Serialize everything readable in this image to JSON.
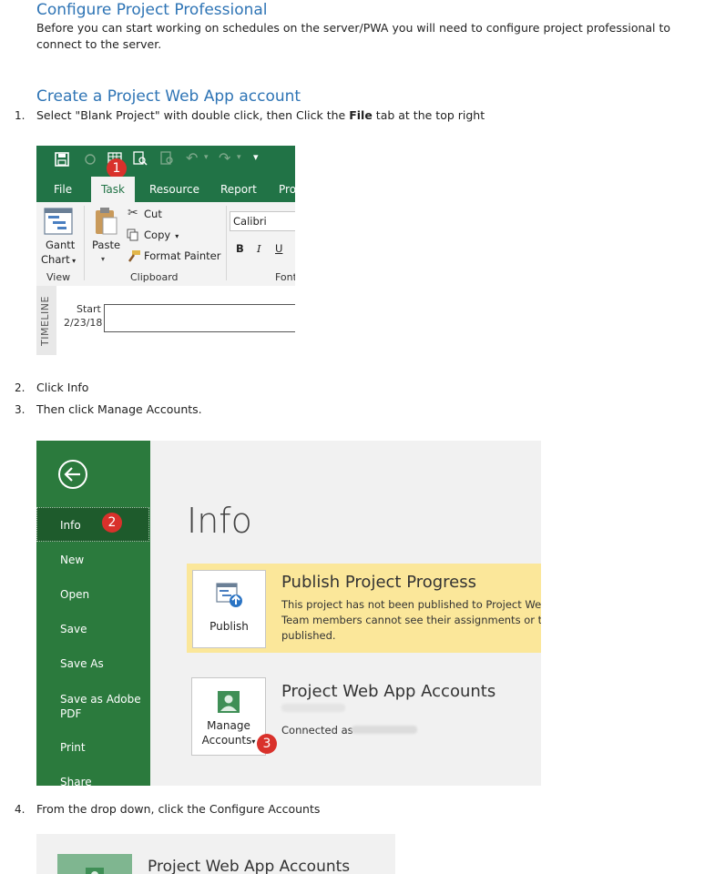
{
  "heading1": "Configure Project Professional",
  "intro": "Before you can start working on schedules on the server/PWA you will need to configure project professional to connect to the server.",
  "heading2": "Create a Project Web App account",
  "steps": [
    {
      "num": "1.",
      "text_a": "Select \"Blank Project\" with double click, then Click the ",
      "bold": "File",
      "text_b": " tab at the top right"
    },
    {
      "num": "2.",
      "text": "Click Info"
    },
    {
      "num": "3.",
      "text": "Then click Manage Accounts."
    },
    {
      "num": "4.",
      "text": "From the drop down, click the Configure Accounts"
    }
  ],
  "ribbon": {
    "badge": "1",
    "tabs": [
      "File",
      "Task",
      "Resource",
      "Report",
      "Pro"
    ],
    "gantt_label_1": "Gantt",
    "gantt_label_2": "Chart",
    "paste_label": "Paste",
    "cut_label": "Cut",
    "copy_label": "Copy",
    "format_painter_label": "Format Painter",
    "font_name": "Calibri",
    "bold_btn": "B",
    "italic_btn": "I",
    "underline_btn": "U",
    "group_view": "View",
    "group_clipboard": "Clipboard",
    "group_font": "Font",
    "timeline_label": "TIMELINE",
    "start_label": "Start",
    "start_date": "2/23/18"
  },
  "backstage": {
    "nav": [
      "Info",
      "New",
      "Open",
      "Save",
      "Save As",
      "Save as Adobe PDF",
      "Print",
      "Share"
    ],
    "badge2": "2",
    "badge3": "3",
    "title": "Info",
    "publish_btn": "Publish",
    "publish_heading": "Publish Project Progress",
    "publish_line1": "This project has not been published to Project Web Ap",
    "publish_line2": "Team members cannot see their assignments or the ov",
    "publish_line3": "published.",
    "manage_btn_1": "Manage",
    "manage_btn_2": "Accounts",
    "pwa_heading": "Project Web App Accounts",
    "connected_as": "Connected as",
    "colors": {
      "nav_green": "#2b7a3d",
      "publish_yellow": "#fbe79a",
      "badge_red": "#d9312b"
    }
  },
  "dropdown": {
    "heading": "Project Web App Accounts"
  }
}
